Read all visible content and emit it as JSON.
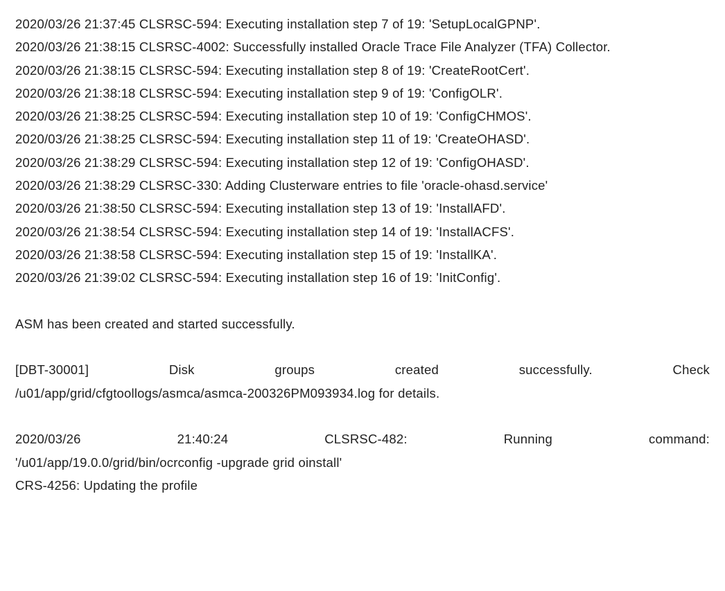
{
  "log": {
    "l1": "2020/03/26 21:37:45 CLSRSC-594: Executing installation step 7 of 19: 'SetupLocalGPNP'.",
    "l2": "2020/03/26 21:38:15 CLSRSC-4002: Successfully installed Oracle Trace File Analyzer (TFA) Collector.",
    "l3": "2020/03/26 21:38:15 CLSRSC-594: Executing installation step 8 of 19: 'CreateRootCert'.",
    "l4": "2020/03/26 21:38:18 CLSRSC-594: Executing installation step 9 of 19: 'ConfigOLR'.",
    "l5": "2020/03/26 21:38:25 CLSRSC-594: Executing installation step 10 of 19: 'ConfigCHMOS'.",
    "l6": "2020/03/26 21:38:25 CLSRSC-594: Executing installation step 11 of 19: 'CreateOHASD'.",
    "l7": "2020/03/26 21:38:29 CLSRSC-594: Executing installation step 12 of 19: 'ConfigOHASD'.",
    "l8": "2020/03/26 21:38:29 CLSRSC-330: Adding Clusterware entries to file 'oracle-ohasd.service'",
    "l9": "2020/03/26 21:38:50 CLSRSC-594: Executing installation step 13 of 19: 'InstallAFD'.",
    "l10": "2020/03/26 21:38:54 CLSRSC-594: Executing installation step 14 of 19: 'InstallACFS'.",
    "l11": "2020/03/26 21:38:58 CLSRSC-594: Executing installation step 15 of 19: 'InstallKA'.",
    "l12": "2020/03/26 21:39:02 CLSRSC-594: Executing installation step 16 of 19: 'InitConfig'.",
    "asm": "ASM has been created and started successfully.",
    "dbt_a": "[DBT-30001] Disk groups created successfully. Check",
    "dbt_b": "/u01/app/grid/cfgtoollogs/asmca/asmca-200326PM093934.log for details.",
    "cmd_a": "2020/03/26 21:40:24 CLSRSC-482: Running command:",
    "cmd_b": "'/u01/app/19.0.0/grid/bin/ocrconfig -upgrade grid oinstall'",
    "crs": "CRS-4256: Updating the profile"
  }
}
